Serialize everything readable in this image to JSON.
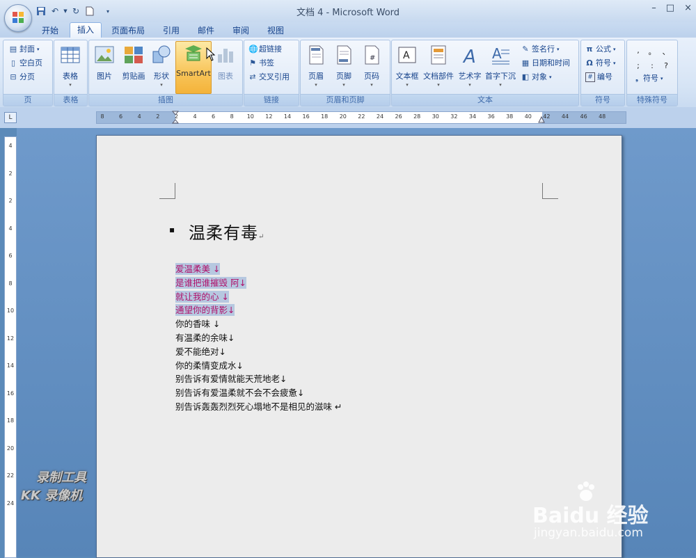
{
  "window": {
    "title": "文档 4 - Microsoft Word",
    "controls": [
      "–",
      "□",
      "×"
    ]
  },
  "quick_access": [
    "save-icon",
    "undo-icon",
    "redo-icon",
    "new-doc-icon",
    "customize-icon"
  ],
  "tabs": [
    {
      "label": "开始",
      "active": false
    },
    {
      "label": "插入",
      "active": true
    },
    {
      "label": "页面布局",
      "active": false
    },
    {
      "label": "引用",
      "active": false
    },
    {
      "label": "邮件",
      "active": false
    },
    {
      "label": "审阅",
      "active": false
    },
    {
      "label": "视图",
      "active": false
    }
  ],
  "ribbon": {
    "groups": {
      "pages": {
        "label": "页",
        "items": [
          "封面",
          "空白页",
          "分页"
        ]
      },
      "tables": {
        "label": "表格",
        "items": [
          "表格"
        ]
      },
      "illustrations": {
        "label": "插图",
        "items": [
          "图片",
          "剪贴画",
          "形状",
          "SmartArt",
          "图表"
        ]
      },
      "links": {
        "label": "链接",
        "items": [
          "超链接",
          "书签",
          "交叉引用"
        ]
      },
      "header_footer": {
        "label": "页眉和页脚",
        "items": [
          "页眉",
          "页脚",
          "页码"
        ]
      },
      "text": {
        "label": "文本",
        "items": [
          "文本框",
          "文档部件",
          "艺术字",
          "首字下沉",
          "签名行",
          "日期和时间",
          "对象"
        ]
      },
      "symbols": {
        "label": "符号",
        "items": [
          "公式",
          "符号",
          "编号"
        ]
      },
      "special": {
        "label": "特殊符号",
        "chars": [
          ",",
          "。",
          "、",
          ";",
          ":",
          "?"
        ],
        "more": "符号"
      }
    }
  },
  "ruler": {
    "h_ticks": [
      "8",
      "6",
      "4",
      "2",
      "2",
      "4",
      "6",
      "8",
      "10",
      "12",
      "14",
      "16",
      "18",
      "20",
      "22",
      "24",
      "26",
      "28",
      "30",
      "32",
      "34",
      "36",
      "38",
      "40",
      "42",
      "44",
      "46",
      "48"
    ],
    "v_ticks": [
      "4",
      "2",
      "2",
      "4",
      "6",
      "8",
      "10",
      "12",
      "14",
      "16",
      "18",
      "20",
      "22",
      "24"
    ]
  },
  "document": {
    "heading": "温柔有毒",
    "lines": [
      {
        "text": "爱温柔美 ↓",
        "selected": true
      },
      {
        "text": "是谁把谁摧毁 阿↓",
        "selected": true
      },
      {
        "text": "就让我的心 ↓",
        "selected": true
      },
      {
        "text": "通望你的背影↓",
        "selected": true
      },
      {
        "text": "你的香味 ↓",
        "selected": false
      },
      {
        "text": "有温柔的余味↓",
        "selected": false
      },
      {
        "text": "爱不能绝对↓",
        "selected": false
      },
      {
        "text": "你的柔情变成水↓",
        "selected": false
      },
      {
        "text": "别告诉有爱情就能天荒地老↓",
        "selected": false
      },
      {
        "text": "别告诉有爱温柔就不会不会疲惫↓",
        "selected": false
      },
      {
        "text": "别告诉轰轰烈烈死心塌地不是相见的滋味 ↵",
        "selected": false
      }
    ]
  },
  "watermarks": {
    "kk_line1": "录制工具",
    "kk_line2": "KK 录像机",
    "baidu_brand": "Baidu 经验",
    "baidu_url": "jingyan.baidu.com"
  }
}
